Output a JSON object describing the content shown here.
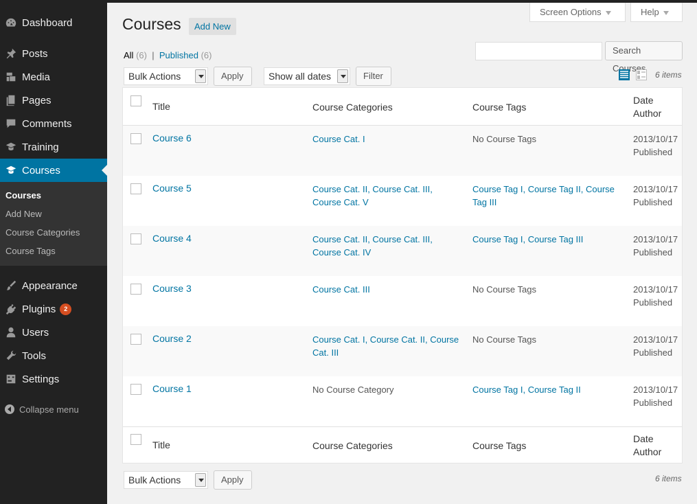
{
  "sidebar": {
    "items": [
      {
        "label": "Dashboard"
      },
      {
        "label": "Posts"
      },
      {
        "label": "Media"
      },
      {
        "label": "Pages"
      },
      {
        "label": "Comments"
      },
      {
        "label": "Training"
      },
      {
        "label": "Courses"
      },
      {
        "label": "Appearance"
      },
      {
        "label": "Plugins",
        "badge": "2"
      },
      {
        "label": "Users"
      },
      {
        "label": "Tools"
      },
      {
        "label": "Settings"
      }
    ],
    "submenu": [
      "Courses",
      "Add New",
      "Course Categories",
      "Course Tags"
    ],
    "collapse": "Collapse menu"
  },
  "header": {
    "title": "Courses",
    "add_new": "Add New",
    "screen_options": "Screen Options",
    "help": "Help"
  },
  "views": {
    "all_label": "All",
    "all_count": "(6)",
    "separator": "|",
    "published_label": "Published",
    "published_count": "(6)"
  },
  "search": {
    "button": "Search Courses",
    "value": ""
  },
  "toolbar": {
    "bulk_actions": "Bulk Actions",
    "apply": "Apply",
    "dates": "Show all dates",
    "filter": "Filter",
    "items_count": "6 items"
  },
  "table": {
    "columns": {
      "title": "Title",
      "categories": "Course Categories",
      "tags": "Course Tags",
      "date": "Date",
      "author": "Author"
    },
    "rows": [
      {
        "title": "Course 6",
        "categories": "Course Cat. I",
        "tags": "No Course Tags",
        "date": "2013/10/17",
        "status": "Published"
      },
      {
        "title": "Course 5",
        "categories": "Course Cat. II, Course Cat. III, Course Cat. V",
        "tags": "Course Tag I, Course Tag II, Course Tag III",
        "date": "2013/10/17",
        "status": "Published"
      },
      {
        "title": "Course 4",
        "categories": "Course Cat. II, Course Cat. III, Course Cat. IV",
        "tags": "Course Tag I, Course Tag III",
        "date": "2013/10/17",
        "status": "Published"
      },
      {
        "title": "Course 3",
        "categories": "Course Cat. III",
        "tags": "No Course Tags",
        "date": "2013/10/17",
        "status": "Published"
      },
      {
        "title": "Course 2",
        "categories": "Course Cat. I, Course Cat. II, Course Cat. III",
        "tags": "No Course Tags",
        "date": "2013/10/17",
        "status": "Published"
      },
      {
        "title": "Course 1",
        "categories": "No Course Category",
        "tags": "Course Tag I, Course Tag II",
        "date": "2013/10/17",
        "status": "Published"
      }
    ]
  },
  "colors": {
    "accent": "#0074a2",
    "sidebar_bg": "#222222",
    "badge": "#d54e21"
  }
}
